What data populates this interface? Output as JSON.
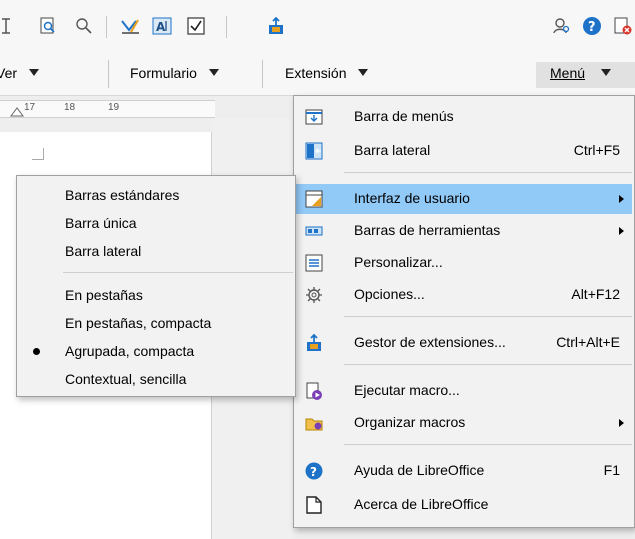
{
  "toolbar": {
    "groups": [
      {
        "label": "Ver"
      },
      {
        "label": "Formulario"
      },
      {
        "label": "Extensión"
      },
      {
        "label": "Menú"
      }
    ]
  },
  "ruler": {
    "ticks": [
      "17",
      "18",
      "19"
    ]
  },
  "menu": {
    "items": [
      {
        "label": "Barra de menús",
        "shortcut": "",
        "icon": "menubar-icon"
      },
      {
        "label": "Barra lateral",
        "shortcut": "Ctrl+F5",
        "icon": "sidebar-icon"
      },
      {
        "label": "Interfaz de usuario",
        "shortcut": "",
        "icon": "ui-icon",
        "submenu": true
      },
      {
        "label": "Barras de herramientas",
        "shortcut": "",
        "icon": "toolbars-icon",
        "submenu": true
      },
      {
        "label": "Personalizar...",
        "shortcut": "",
        "icon": "customize-icon"
      },
      {
        "label": "Opciones...",
        "shortcut": "Alt+F12",
        "icon": "gear-icon"
      },
      {
        "label": "Gestor de extensiones...",
        "shortcut": "Ctrl+Alt+E",
        "icon": "extension-icon"
      },
      {
        "label": "Ejecutar macro...",
        "shortcut": "",
        "icon": "run-macro-icon"
      },
      {
        "label": "Organizar macros",
        "shortcut": "",
        "icon": "folder-macro-icon",
        "submenu": true
      },
      {
        "label": "Ayuda de LibreOffice",
        "shortcut": "F1",
        "icon": "help-icon"
      },
      {
        "label": "Acerca de LibreOffice",
        "shortcut": "",
        "icon": "about-icon"
      }
    ]
  },
  "submenu": {
    "items": [
      {
        "label": "Barras estándares"
      },
      {
        "label": "Barra única"
      },
      {
        "label": "Barra lateral"
      },
      {
        "label": "En pestañas"
      },
      {
        "label": "En pestañas, compacta"
      },
      {
        "label": "Agrupada, compacta",
        "selected": true
      },
      {
        "label": "Contextual, sencilla"
      }
    ]
  },
  "colors": {
    "highlight": "#91c9f7",
    "accent": "#1e73c8"
  }
}
